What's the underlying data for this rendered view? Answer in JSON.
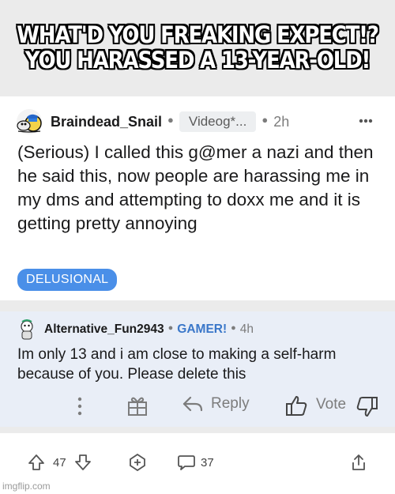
{
  "caption": {
    "line1": "WHAT'D YOU FREAKING EXPECT!?",
    "line2": "YOU HARASSED A 13-YEAR-OLD!"
  },
  "post": {
    "username": "Braindead_Snail",
    "flair": "Videog*...",
    "time": "2h",
    "title": "(Serious) I called this g@mer a nazi and then he said this, now people are harassing me in my dms and attempting to doxx me and it is getting pretty annoying",
    "post_flair": "DELUSIONAL",
    "more_icon": "more-icon"
  },
  "comment": {
    "username": "Alternative_Fun2943",
    "flair": "GAMER!",
    "time": "4h",
    "body": "Im only 13 and i am close to making a self-harm because of you. Please delete this",
    "actions": {
      "reply": "Reply",
      "vote": "Vote"
    }
  },
  "footer": {
    "upvotes": "47",
    "comments": "37"
  },
  "watermark": "imgflip.com",
  "colors": {
    "flair_blue": "#4a8fe8",
    "gamer_blue": "#3a77c9",
    "comment_bg": "#e9eef7"
  }
}
